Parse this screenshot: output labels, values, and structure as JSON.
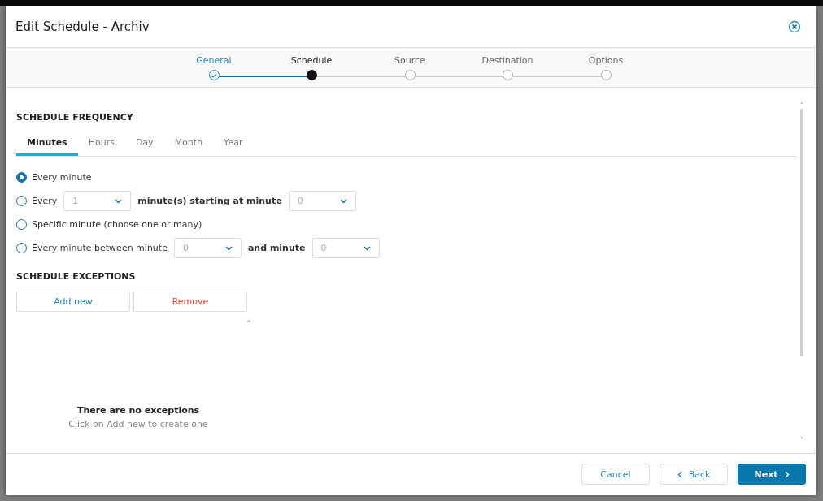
{
  "dialog": {
    "title": "Edit Schedule - Archiv"
  },
  "steps": [
    {
      "label": "General",
      "completed": true,
      "selected": false
    },
    {
      "label": "Schedule",
      "completed": false,
      "selected": true
    },
    {
      "label": "Source",
      "completed": false,
      "selected": false
    },
    {
      "label": "Destination",
      "completed": false,
      "selected": false
    },
    {
      "label": "Options",
      "completed": false,
      "selected": false
    }
  ],
  "frequency": {
    "heading": "SCHEDULE FREQUENCY",
    "tabs": [
      {
        "label": "Minutes",
        "selected": true
      },
      {
        "label": "Hours",
        "selected": false
      },
      {
        "label": "Day",
        "selected": false
      },
      {
        "label": "Month",
        "selected": false
      },
      {
        "label": "Year",
        "selected": false
      }
    ],
    "options": [
      {
        "selected": true,
        "parts": [
          {
            "kind": "text",
            "text": "Every minute"
          }
        ]
      },
      {
        "selected": false,
        "parts": [
          {
            "kind": "text",
            "text": "Every"
          },
          {
            "kind": "select",
            "value": "1"
          },
          {
            "kind": "bold",
            "text": "minute(s) starting at minute"
          },
          {
            "kind": "select",
            "value": "0"
          }
        ]
      },
      {
        "selected": false,
        "parts": [
          {
            "kind": "text",
            "text": "Specific minute (choose one or many)"
          }
        ]
      },
      {
        "selected": false,
        "parts": [
          {
            "kind": "text",
            "text": "Every minute between minute"
          },
          {
            "kind": "select",
            "value": "0"
          },
          {
            "kind": "bold",
            "text": "and minute"
          },
          {
            "kind": "select",
            "value": "0"
          }
        ]
      }
    ]
  },
  "exceptions": {
    "heading": "SCHEDULE EXCEPTIONS",
    "buttons": [
      {
        "label": "Add new",
        "kind": "primary"
      },
      {
        "label": "Remove",
        "kind": "danger"
      }
    ],
    "empty_title": "There are no exceptions",
    "empty_hint": "Click on Add new to create one"
  },
  "footer": {
    "buttons": [
      {
        "label": "Cancel",
        "kind": "plain"
      },
      {
        "label": "Back",
        "kind": "back"
      },
      {
        "label": "Next",
        "kind": "next"
      }
    ]
  }
}
